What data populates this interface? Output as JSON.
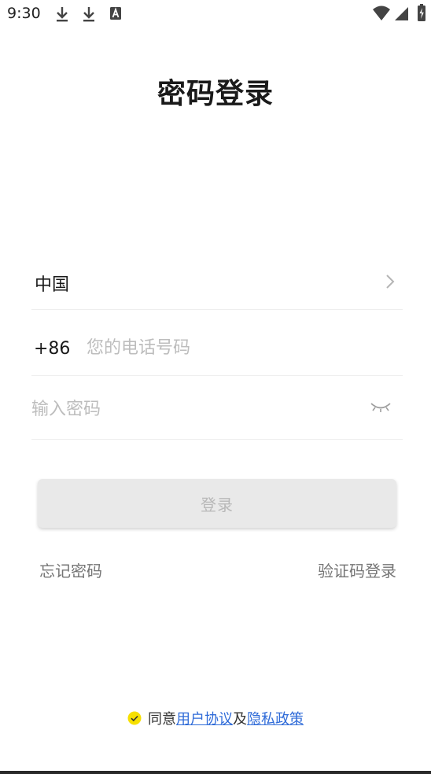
{
  "status_bar": {
    "time": "9:30",
    "icons": [
      "download-icon",
      "download-icon",
      "a-icon",
      "wifi-icon",
      "signal-icon",
      "battery-icon"
    ]
  },
  "page": {
    "title": "密码登录"
  },
  "country": {
    "label": "中国"
  },
  "phone": {
    "dial_code": "+86",
    "placeholder": "您的电话号码",
    "value": ""
  },
  "password": {
    "placeholder": "输入密码",
    "value": ""
  },
  "login_button": {
    "label": "登录"
  },
  "links": {
    "forgot_password": "忘记密码",
    "sms_login": "验证码登录"
  },
  "agreement": {
    "prefix": "同意",
    "user_agreement": "用户协议",
    "conjunction": "及",
    "privacy_policy": "隐私政策",
    "checked": true
  },
  "colors": {
    "accent_check": "#f7e000",
    "link": "#2f6bd8",
    "button_bg": "#e9e9e9",
    "button_text": "#b8b8b8"
  }
}
